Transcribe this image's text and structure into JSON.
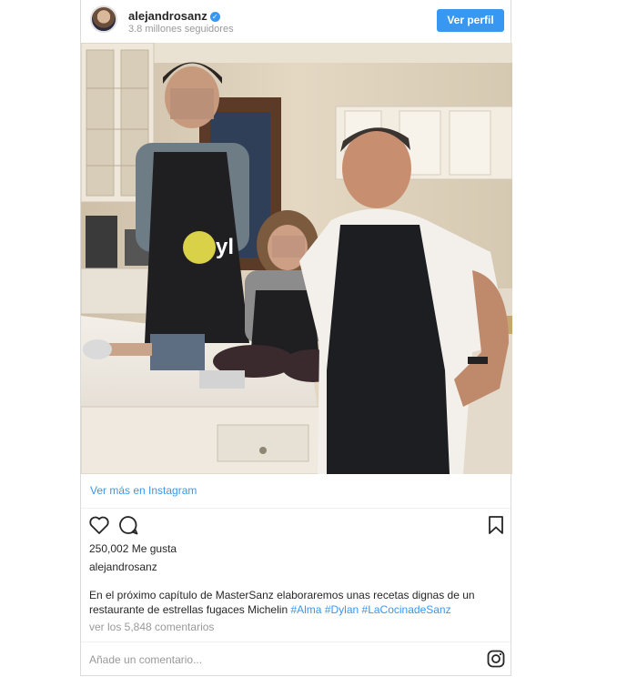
{
  "header": {
    "username": "alejandrosanz",
    "followers": "3.8 millones seguidores",
    "profile_button": "Ver perfil"
  },
  "post": {
    "photo_alt": "",
    "view_more": "Ver más en Instagram",
    "likes": "250,002 Me gusta",
    "author": "alejandrosanz",
    "caption_text": "En el próximo capítulo de MasterSanz elaboraremos unas recetas dignas de un restaurante de estrellas fugaces Michelin ",
    "hashtags": [
      "#Alma",
      "#Dylan",
      "#LaCocinadeSanz"
    ],
    "comments_link": "ver los 5,848 comentarios",
    "comment_placeholder": "Añade un comentario..."
  },
  "icons": {
    "like": "heart-icon",
    "comment": "comment-icon",
    "save": "bookmark-icon",
    "instagram": "instagram-icon",
    "verified": "verified-badge-icon"
  },
  "colors": {
    "accent": "#3897f0",
    "text": "#262626",
    "muted": "#999999",
    "border": "#dbdbdb"
  }
}
